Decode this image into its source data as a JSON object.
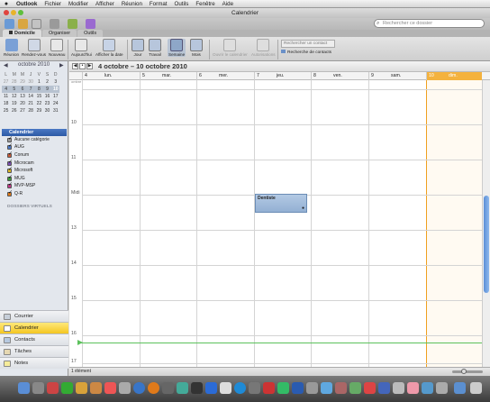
{
  "menubar": {
    "app": "Outlook",
    "items": [
      "Fichier",
      "Modifier",
      "Afficher",
      "Réunion",
      "Format",
      "Outils",
      "Fenêtre",
      "Aide"
    ]
  },
  "window": {
    "title": "Calendrier"
  },
  "search": {
    "placeholder": "Rechercher ce dossier"
  },
  "ribbon_tabs": [
    "Domicile",
    "Organiser",
    "Outils"
  ],
  "ribbon": {
    "buttons": [
      {
        "label": "Réunion",
        "icon": "meeting-icon"
      },
      {
        "label": "Rendez-vous",
        "icon": "appointment-icon"
      },
      {
        "label": "Nouveau",
        "icon": "new-icon"
      },
      {
        "label": "Aujourd'hui",
        "icon": "today-icon"
      },
      {
        "label": "Afficher la date",
        "icon": "show-date-icon"
      },
      {
        "label": "Jour",
        "icon": "day-view-icon"
      },
      {
        "label": "Travail",
        "icon": "work-week-icon"
      },
      {
        "label": "Semaine",
        "icon": "week-view-icon"
      },
      {
        "label": "Mois",
        "icon": "month-view-icon"
      },
      {
        "label": "Ouvrir le calendrier",
        "icon": "open-calendar-icon"
      },
      {
        "label": "Autorisations",
        "icon": "permissions-icon"
      }
    ],
    "contact_search_placeholder": "Rechercher un contact",
    "contact_link": "Recherche de contacts"
  },
  "mini_calendar": {
    "month_label": "octobre 2010",
    "weekday_labels": [
      "L",
      "M",
      "M",
      "J",
      "V",
      "S",
      "D"
    ],
    "weeks": [
      [
        "27",
        "28",
        "29",
        "30",
        "1",
        "2",
        "3"
      ],
      [
        "4",
        "5",
        "6",
        "7",
        "8",
        "9",
        "10"
      ],
      [
        "11",
        "12",
        "13",
        "14",
        "15",
        "16",
        "17"
      ],
      [
        "18",
        "19",
        "20",
        "21",
        "22",
        "23",
        "24"
      ],
      [
        "25",
        "26",
        "27",
        "28",
        "29",
        "30",
        "31"
      ]
    ],
    "today": "10"
  },
  "calendars": {
    "header": "Calendrier",
    "items": [
      "Aucune catégorie",
      "AUG",
      "Conum",
      "Microcam",
      "Microsoft",
      "MUG",
      "MVP-MSP",
      "Q-R"
    ],
    "colors": [
      "#9a9a9a",
      "#4d7ac8",
      "#c85a3a",
      "#7a4fb2",
      "#d6b42a",
      "#3d9a3d",
      "#c33a8a",
      "#e07a1a"
    ],
    "virtual_folders": "DOSSIERS VIRTUELS"
  },
  "nav": {
    "items": [
      "Courrier",
      "Calendrier",
      "Contacts",
      "Tâches",
      "Notes"
    ],
    "active": "Calendrier"
  },
  "week": {
    "range": "4 octobre – 10 octobre 2010",
    "days": [
      {
        "num": "4",
        "name": "lun."
      },
      {
        "num": "5",
        "name": "mar."
      },
      {
        "num": "6",
        "name": "mer."
      },
      {
        "num": "7",
        "name": "jeu."
      },
      {
        "num": "8",
        "name": "ven."
      },
      {
        "num": "9",
        "name": "sam."
      },
      {
        "num": "10",
        "name": "dim."
      }
    ],
    "hour_labels": [
      "10",
      "11",
      "Midi",
      "13",
      "14",
      "15",
      "16",
      "17"
    ],
    "all_day_label": "ombre"
  },
  "event": {
    "title": "Dentiste",
    "day": "7 jeu."
  },
  "status": {
    "count": "1 élément"
  }
}
